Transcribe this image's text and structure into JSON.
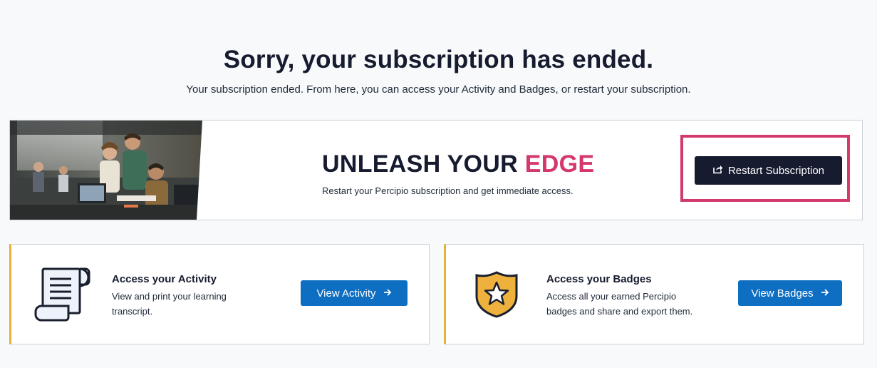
{
  "header": {
    "title": "Sorry, your subscription has ended.",
    "subtitle": "Your subscription ended. From here, you can access your Activity and Badges, or restart your subscription."
  },
  "banner": {
    "heading_main": "UNLEASH YOUR ",
    "heading_accent": "EDGE",
    "text": "Restart your Percipio subscription and get immediate access.",
    "button_label": "Restart Subscription",
    "button_icon": "share-icon",
    "image": "office-team-photo",
    "accent_color": "#d4376a",
    "highlight_color": "#d23a6d"
  },
  "cards": {
    "activity": {
      "title": "Access your Activity",
      "description": "View and print your learning transcript.",
      "button_label": "View Activity",
      "icon": "scroll-icon"
    },
    "badges": {
      "title": "Access your Badges",
      "description": "Access all your earned Percipio badges and share and export them.",
      "button_label": "View Badges",
      "icon": "shield-star-icon"
    }
  },
  "colors": {
    "primary_dark": "#171b2f",
    "primary_blue": "#0d6ec2",
    "card_accent": "#e8b13a"
  }
}
